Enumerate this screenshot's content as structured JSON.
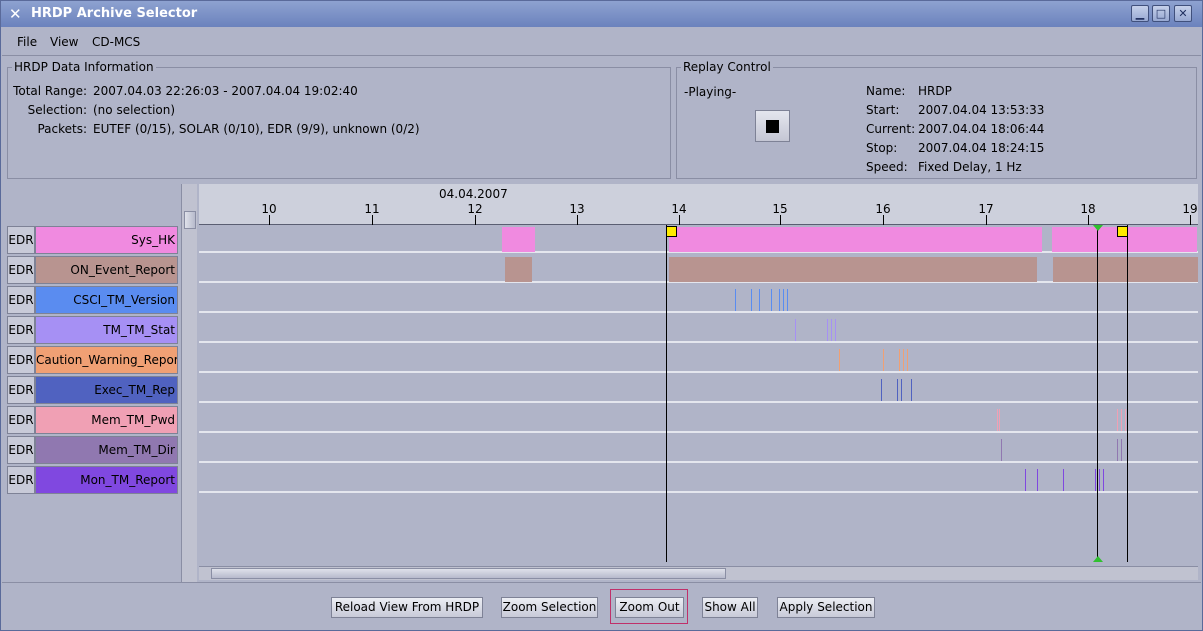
{
  "window": {
    "title": "HRDP Archive Selector"
  },
  "menu": [
    "File",
    "View",
    "CD-MCS"
  ],
  "info": {
    "title": "HRDP Data Information",
    "total_range_label": "Total Range:",
    "total_range": "2007.04.03 22:26:03 - 2007.04.04 19:02:40",
    "selection_label": "Selection:",
    "selection": "(no selection)",
    "packets_label": "Packets:",
    "packets": "EUTEF (0/15), SOLAR (0/10), EDR (9/9), unknown (0/2)"
  },
  "replay": {
    "title": "Replay Control",
    "state": "-Playing-",
    "name_label": "Name:",
    "name": "HRDP",
    "start_label": "Start:",
    "start": "2007.04.04 13:53:33",
    "current_label": "Current:",
    "current": "2007.04.04 18:06:44",
    "stop_label": "Stop:",
    "stop": "2007.04.04 18:24:15",
    "speed_label": "Speed:",
    "speed": "Fixed Delay, 1 Hz"
  },
  "timeline": {
    "date": "04.04.2007",
    "hours": [
      "10",
      "11",
      "12",
      "13",
      "14",
      "15",
      "16",
      "17",
      "18",
      "19"
    ]
  },
  "tracks": [
    {
      "source": "EDR",
      "name": "Sys_HK",
      "color": "#f08ae0"
    },
    {
      "source": "EDR",
      "name": "ON_Event_Report",
      "color": "#b89490"
    },
    {
      "source": "EDR",
      "name": "CSCI_TM_Version",
      "color": "#5a8cf0"
    },
    {
      "source": "EDR",
      "name": "TM_TM_Stat",
      "color": "#a690f4"
    },
    {
      "source": "EDR",
      "name": "Caution_Warning_Report",
      "color": "#f0a074"
    },
    {
      "source": "EDR",
      "name": "Exec_TM_Rep",
      "color": "#5062c0"
    },
    {
      "source": "EDR",
      "name": "Mem_TM_Pwd",
      "color": "#f0a0b4"
    },
    {
      "source": "EDR",
      "name": "Mem_TM_Dir",
      "color": "#9078b0"
    },
    {
      "source": "EDR",
      "name": "Mon_TM_Report",
      "color": "#8048e0"
    }
  ],
  "buttons": {
    "reload": "Reload View From HRDP",
    "zoom_selection": "Zoom Selection",
    "zoom_out": "Zoom Out",
    "show_all": "Show All",
    "apply_selection": "Apply Selection"
  }
}
